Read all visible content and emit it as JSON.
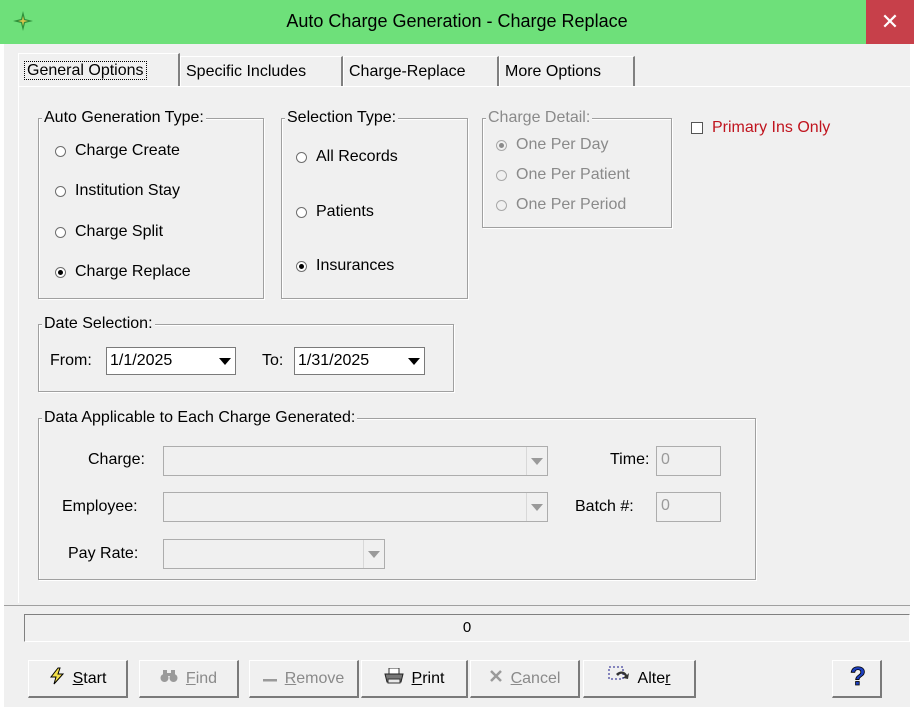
{
  "window": {
    "title": "Auto Charge Generation - Charge Replace",
    "close_glyph": "✕",
    "app_icon": "sparkle-icon"
  },
  "tabs": [
    {
      "label": "General Options",
      "active": true
    },
    {
      "label": "Specific Includes",
      "active": false
    },
    {
      "label": "Charge-Replace",
      "active": false
    },
    {
      "label": "More Options",
      "active": false
    }
  ],
  "auto_generation_type": {
    "legend": "Auto Generation Type:",
    "options": [
      {
        "label": "Charge Create",
        "checked": false
      },
      {
        "label": "Institution Stay",
        "checked": false
      },
      {
        "label": "Charge Split",
        "checked": false
      },
      {
        "label": "Charge Replace",
        "checked": true
      }
    ]
  },
  "selection_type": {
    "legend": "Selection Type:",
    "options": [
      {
        "label": "All Records",
        "checked": false
      },
      {
        "label": "Patients",
        "checked": false
      },
      {
        "label": "Insurances",
        "checked": true
      }
    ]
  },
  "charge_detail": {
    "legend": "Charge Detail:",
    "options": [
      {
        "label": "One Per Day",
        "checked": true
      },
      {
        "label": "One Per Patient",
        "checked": false
      },
      {
        "label": "One Per Period",
        "checked": false
      }
    ]
  },
  "primary_ins_only": {
    "label": "Primary Ins Only",
    "checked": false,
    "color": "#c0141e"
  },
  "date_selection": {
    "legend": "Date Selection:",
    "from_label": "From:",
    "from_value": "1/1/2025",
    "to_label": "To:",
    "to_value": "1/31/2025"
  },
  "charge_data": {
    "legend": "Data Applicable to Each Charge Generated:",
    "charge_label": "Charge:",
    "charge_value": "",
    "employee_label": "Employee:",
    "employee_value": "",
    "pay_rate_label": "Pay Rate:",
    "pay_rate_value": "",
    "time_label": "Time:",
    "time_value": "0",
    "batch_label": "Batch #:",
    "batch_value": "0"
  },
  "progress": {
    "value": "0"
  },
  "toolbar": {
    "start": {
      "mnemonic": "S",
      "rest": "tart",
      "icon": "lightning-icon"
    },
    "find": {
      "mnemonic": "F",
      "rest": "ind",
      "icon": "binoculars-icon"
    },
    "remove": {
      "mnemonic": "R",
      "rest": "emove",
      "icon": "minus-icon"
    },
    "print": {
      "mnemonic": "P",
      "rest": "rint",
      "icon": "printer-icon"
    },
    "cancel": {
      "mnemonic": "C",
      "rest": "ancel",
      "icon": "x-icon"
    },
    "alter": {
      "prefix": "Alte",
      "mnemonic": "r",
      "icon": "alter-icon"
    },
    "help": {
      "glyph": "?",
      "icon": "help-icon"
    }
  }
}
